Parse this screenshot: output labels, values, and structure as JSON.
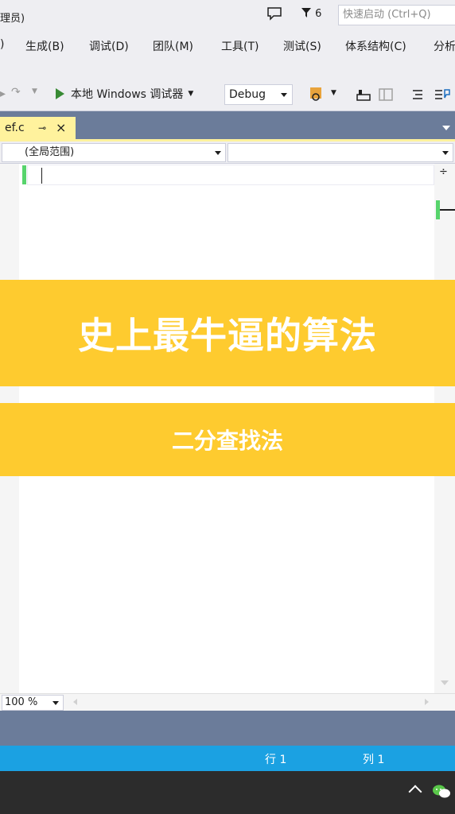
{
  "window": {
    "title_fragment": "理员)",
    "notification_count": "6",
    "quick_launch_placeholder": "快速启动 (Ctrl+Q)"
  },
  "menu": {
    "items": [
      ")",
      "生成(B)",
      "调试(D)",
      "团队(M)",
      "工具(T)",
      "测试(S)",
      "体系结构(C)",
      "分析"
    ]
  },
  "toolbar": {
    "run_label": "本地 Windows 调试器",
    "configuration": "Debug"
  },
  "editor": {
    "tab_label": "ef.c",
    "scope": "(全局范围)",
    "member": "",
    "zoom": "100 %"
  },
  "status": {
    "line": "行 1",
    "column": "列 1"
  },
  "overlay": {
    "headline": "史上最牛逼的算法",
    "subtitle": "二分查找法"
  },
  "colors": {
    "banner": "#fecb2f",
    "status_bar": "#1ba1e2",
    "tab_active": "#fff29d",
    "change_marker": "#57d46c"
  }
}
